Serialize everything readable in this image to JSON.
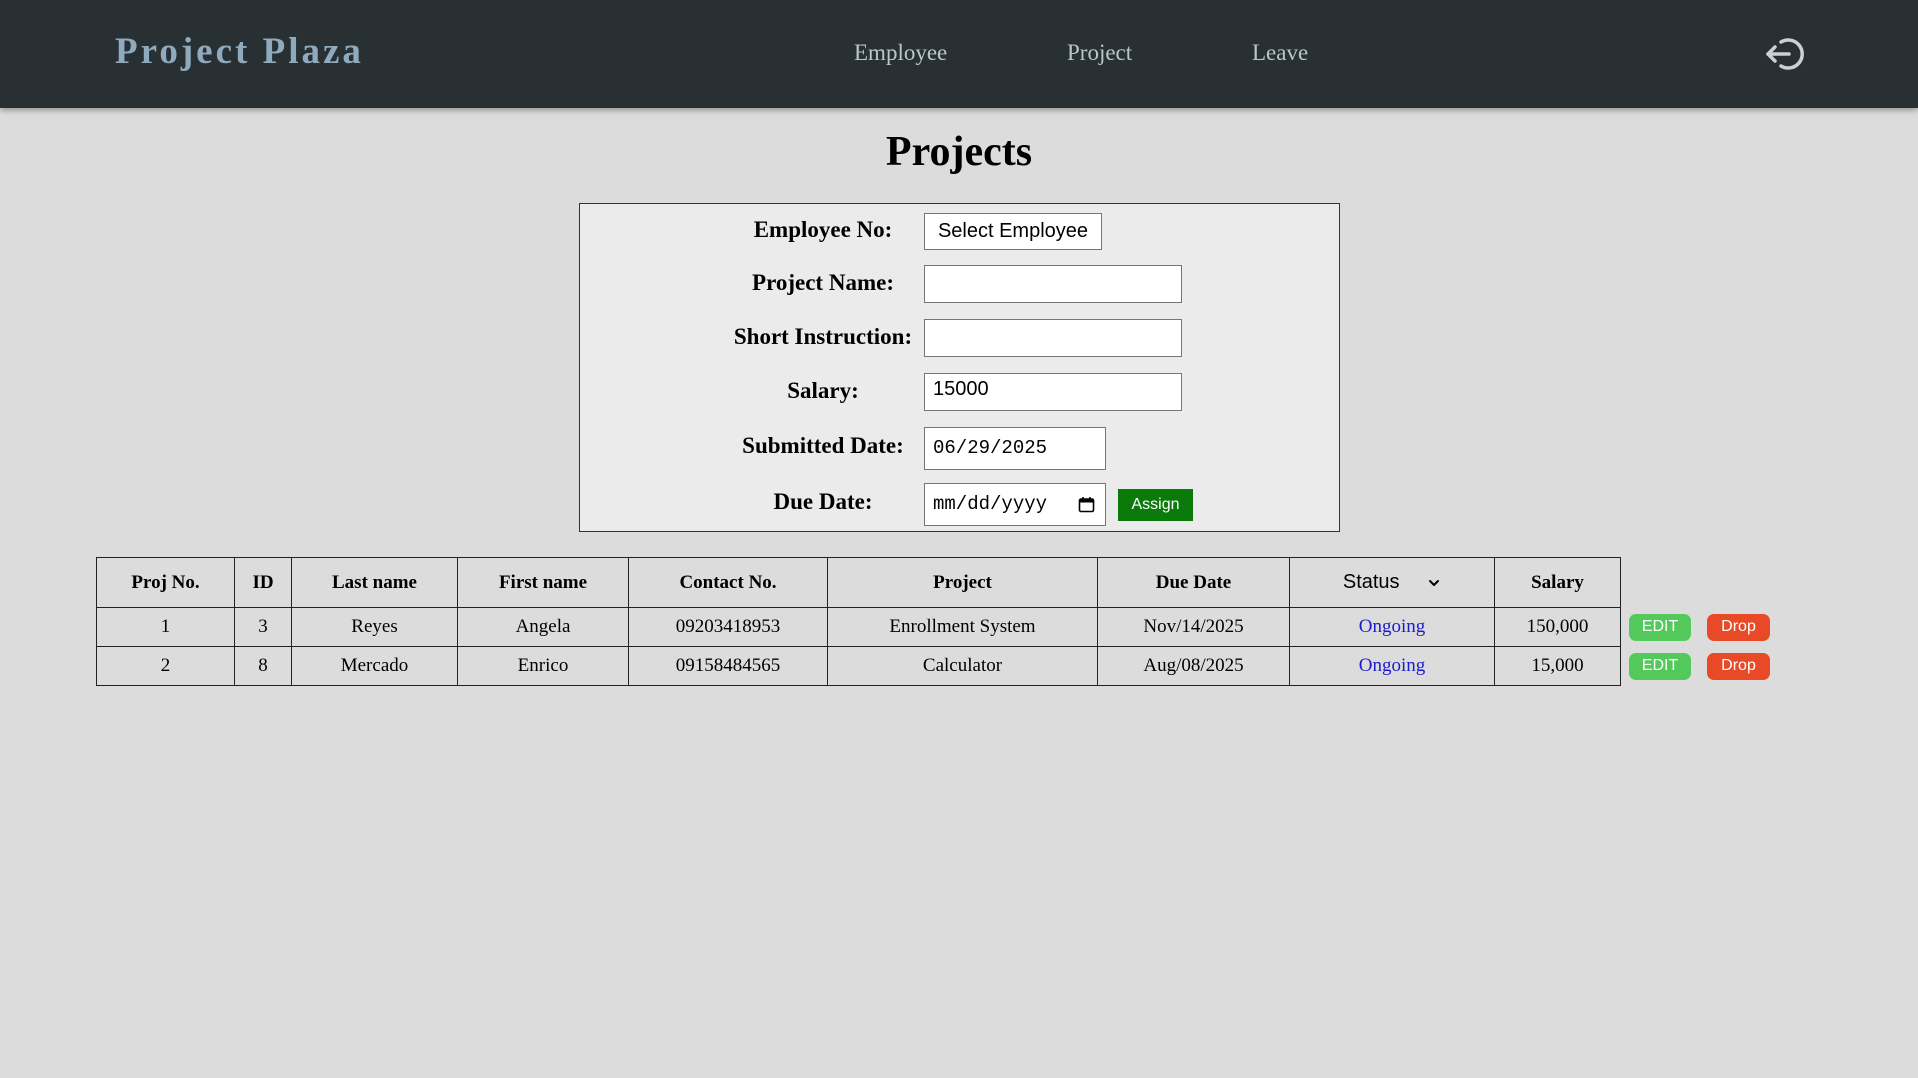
{
  "header": {
    "brand": "Project Plaza",
    "nav": [
      "Employee",
      "Project",
      "Leave"
    ],
    "logout_icon": "logout-icon"
  },
  "page": {
    "title": "Projects"
  },
  "form": {
    "employee_label": "Employee No:",
    "employee_select": "Select Employee",
    "project_name_label": "Project Name:",
    "project_name_value": "",
    "instruction_label": "Short Instruction:",
    "instruction_value": "",
    "salary_label": "Salary:",
    "salary_value": "15000",
    "submitted_label": "Submitted Date:",
    "submitted_value": "06/29/2025",
    "due_label": "Due Date:",
    "due_value": "mm/dd/yyyy",
    "assign_label": "Assign"
  },
  "table": {
    "headers": [
      "Proj No.",
      "ID",
      "Last name",
      "First name",
      "Contact No.",
      "Project",
      "Due Date",
      "Status",
      "Salary"
    ],
    "rows": [
      [
        "1",
        "3",
        "Reyes",
        "Angela",
        "09203418953",
        "Enrollment System",
        "Nov/14/2025",
        "Ongoing",
        "150,000"
      ],
      [
        "2",
        "8",
        "Mercado",
        "Enrico",
        "09158484565",
        "Calculator",
        "Aug/08/2025",
        "Ongoing",
        "15,000"
      ]
    ],
    "edit_label": "EDIT",
    "drop_label": "Drop"
  },
  "colors": {
    "navbar": "#283034",
    "brand": "#8fa9bd",
    "assign": "#0a7a0a",
    "edit": "#52c95a",
    "drop": "#e84a28",
    "status": "#1c1ccc"
  }
}
